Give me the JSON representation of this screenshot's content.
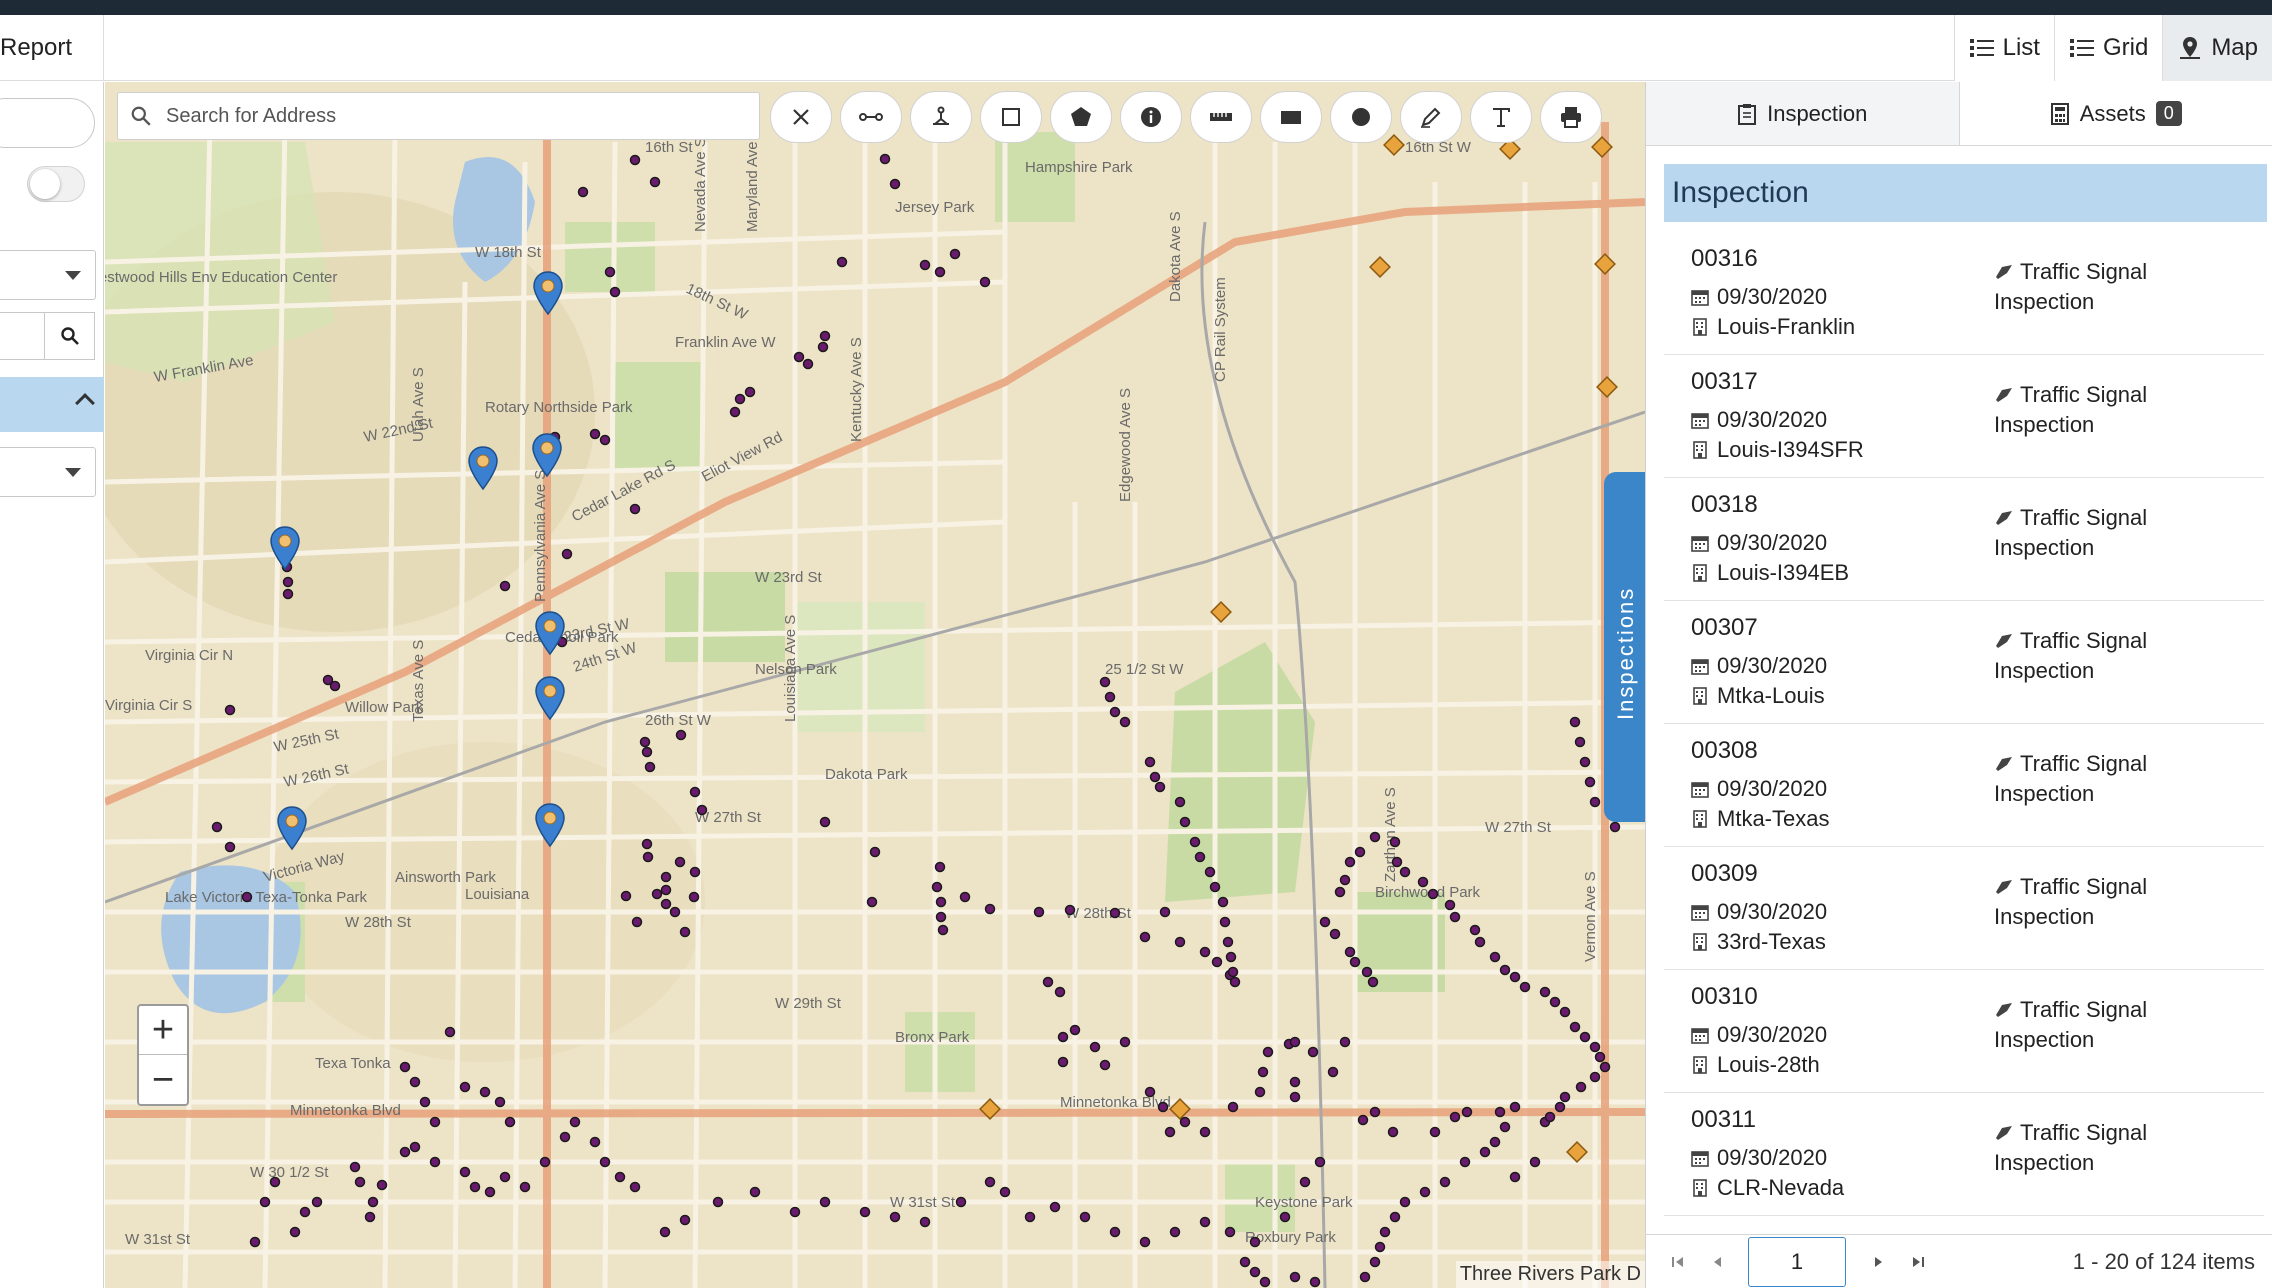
{
  "header": {
    "report_label": "Report",
    "views": [
      {
        "label": "List",
        "icon": "list-icon"
      },
      {
        "label": "Grid",
        "icon": "grid-icon"
      },
      {
        "label": "Map",
        "icon": "map-pin-icon",
        "active": true
      }
    ]
  },
  "map": {
    "search_placeholder": "Search for Address",
    "tools": [
      "close-icon",
      "measure-line-icon",
      "bike-route-icon",
      "rectangle-icon",
      "polygon-icon",
      "info-icon",
      "ruler-icon",
      "rectangle-fill-icon",
      "circle-icon",
      "draw-icon",
      "text-icon",
      "print-icon"
    ],
    "zoom_in": "+",
    "zoom_out": "−",
    "attribution": "Three Rivers Park D",
    "drawer_label": "Inspections",
    "street_labels": [
      "16th St",
      "16th St W",
      "W 18th St",
      "18th St W",
      "Franklin Ave W",
      "Westwood Hills Env Education Center",
      "W Franklin Ave",
      "W 22nd St",
      "Rotary Northside Park",
      "Cedar Lake Rd S",
      "Eliot View Rd",
      "W 23rd St",
      "23rd St W",
      "24th St W",
      "Cedar Knoll Park",
      "Nelson Park",
      "25 1/2 St W",
      "Virginia Cir N",
      "Virginia Cir S",
      "Willow Park",
      "W 25th St",
      "W 26th St",
      "26th St W",
      "Dakota Park",
      "W 27th St",
      "W 27th St",
      "Victoria Way",
      "Ainsworth Park",
      "Louisiana",
      "Lake Victoria Texa-Tonka Park",
      "W 28th St",
      "W 28th St",
      "Birchwood Park",
      "W 29th St",
      "Bronx Park",
      "Texa Tonka",
      "Minnetonka Blvd",
      "Minnetonka Blvd",
      "W 30 1/2 St",
      "W 31st St",
      "W 31st St",
      "Keystone Park",
      "Roxbury Park",
      "Hampshire Park",
      "Jersey Park",
      "Texas Ave S",
      "Louisiana Ave S",
      "Dakota Ave S",
      "CP Rail System",
      "Pennsylvania Ave S",
      "Utah Ave S",
      "Nevada Ave S",
      "Maryland Ave S",
      "Kentucky Ave S",
      "Edgewood Ave S",
      "Zarthan Ave S",
      "Vernon Ave S"
    ],
    "colors": {
      "land": "#ede3c6",
      "park": "#c9dba4",
      "water": "#a9c7e3",
      "road": "#e8a17a",
      "pin": "#3a7fd0",
      "marker": "#6a1b6e"
    }
  },
  "inspection_panel": {
    "tab_inspection": "Inspection",
    "tab_assets": "Assets",
    "assets_count": "0",
    "title": "Inspection",
    "items": [
      {
        "id": "00316",
        "date": "09/30/2020",
        "location": "Louis-Franklin",
        "type": "Traffic Signal Inspection"
      },
      {
        "id": "00317",
        "date": "09/30/2020",
        "location": "Louis-I394SFR",
        "type": "Traffic Signal Inspection"
      },
      {
        "id": "00318",
        "date": "09/30/2020",
        "location": "Louis-I394EB",
        "type": "Traffic Signal Inspection"
      },
      {
        "id": "00307",
        "date": "09/30/2020",
        "location": "Mtka-Louis",
        "type": "Traffic Signal Inspection"
      },
      {
        "id": "00308",
        "date": "09/30/2020",
        "location": "Mtka-Texas",
        "type": "Traffic Signal Inspection"
      },
      {
        "id": "00309",
        "date": "09/30/2020",
        "location": "33rd-Texas",
        "type": "Traffic Signal Inspection"
      },
      {
        "id": "00310",
        "date": "09/30/2020",
        "location": "Louis-28th",
        "type": "Traffic Signal Inspection"
      },
      {
        "id": "00311",
        "date": "09/30/2020",
        "location": "CLR-Nevada",
        "type": "Traffic Signal Inspection"
      }
    ],
    "pager": {
      "page": "1",
      "summary": "1 - 20 of 124 items"
    }
  }
}
